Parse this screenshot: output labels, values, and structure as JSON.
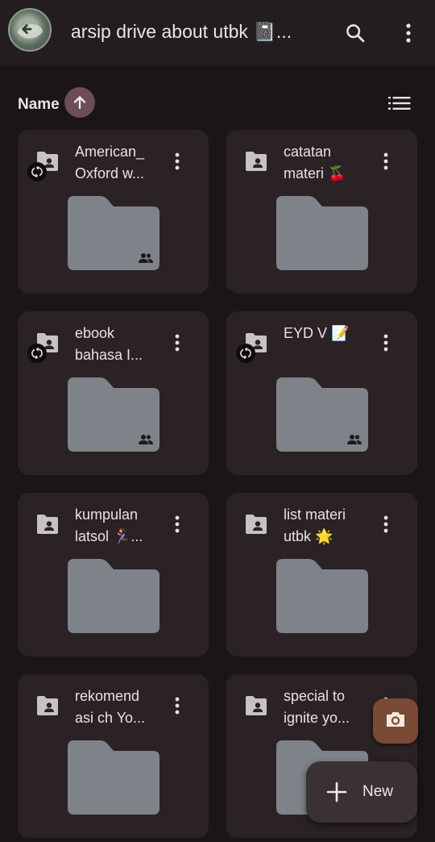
{
  "header": {
    "title": "arsip drive about utbk 📓...",
    "avatar_icon": "profile-avatar",
    "search_icon": "search-icon",
    "more_icon": "more-vert-icon"
  },
  "sort": {
    "label": "Name",
    "direction_icon": "arrow-up-icon",
    "view_icon": "list-view-icon"
  },
  "folders": [
    {
      "line1": "American_",
      "line2": "Oxford w...",
      "shared": true,
      "syncing": true
    },
    {
      "line1": "catatan",
      "line2": "materi 🍒",
      "shared": false,
      "syncing": false
    },
    {
      "line1": "ebook",
      "line2": "bahasa I...",
      "shared": true,
      "syncing": true
    },
    {
      "line1": "EYD V 📝",
      "line2": "",
      "shared": true,
      "syncing": true
    },
    {
      "line1": "kumpulan",
      "line2": "latsol 🏃‍♀️...",
      "shared": false,
      "syncing": false
    },
    {
      "line1": "list materi",
      "line2": "utbk 🌟",
      "shared": false,
      "syncing": false
    },
    {
      "line1": "rekomend",
      "line2": "asi ch Yo...",
      "shared": false,
      "syncing": false
    },
    {
      "line1": "special to",
      "line2": "ignite yo...",
      "shared": false,
      "syncing": false
    }
  ],
  "fab": {
    "camera_icon": "camera-icon",
    "new_label": "New",
    "new_icon": "plus-icon"
  },
  "colors": {
    "background": "#1a1517",
    "card": "#2a2225",
    "folder_thumb": "#7e8389",
    "sort_accent": "#6d4d58",
    "camera_fab": "#7a4a36"
  }
}
